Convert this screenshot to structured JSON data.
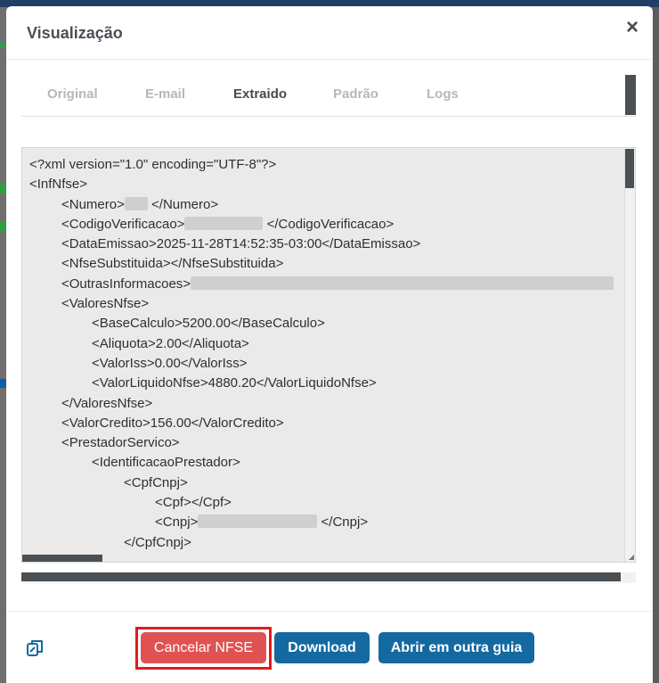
{
  "modal": {
    "title": "Visualização",
    "close_label": "×"
  },
  "tabs": [
    {
      "label": "Original",
      "active": false
    },
    {
      "label": "E-mail",
      "active": false
    },
    {
      "label": "Extraido",
      "active": true
    },
    {
      "label": "Padrão",
      "active": false
    },
    {
      "label": "Logs",
      "active": false
    }
  ],
  "xml": {
    "declaration": "<?xml version=\"1.0\" encoding=\"UTF-8\"?>",
    "inf_open": "<InfNfse>",
    "numero_open": "<Numero>",
    "numero_close": "</Numero>",
    "codver_open": "<CodigoVerificacao>",
    "codver_close": "</CodigoVerificacao>",
    "data_emissao": "<DataEmissao>2025-11-28T14:52:35-03:00</DataEmissao>",
    "nfse_subst": "<NfseSubstituida></NfseSubstituida>",
    "outras_open": "<OutrasInformacoes>",
    "valores_open": "<ValoresNfse>",
    "base_calculo": "<BaseCalculo>5200.00</BaseCalculo>",
    "aliquota": "<Aliquota>2.00</Aliquota>",
    "valor_iss": "<ValorIss>0.00</ValorIss>",
    "valor_liquido": "<ValorLiquidoNfse>4880.20</ValorLiquidoNfse>",
    "valores_close": "</ValoresNfse>",
    "valor_credito": "<ValorCredito>156.00</ValorCredito>",
    "prestador_open": "<PrestadorServico>",
    "ident_open": "<IdentificacaoPrestador>",
    "cpfcnpj_open": "<CpfCnpj>",
    "cpf": "<Cpf></Cpf>",
    "cnpj_open": "<Cnpj>",
    "cnpj_close": "</Cnpj>",
    "cpfcnpj_close": "</CpfCnpj>"
  },
  "footer": {
    "cancel_label": "Cancelar NFSE",
    "download_label": "Download",
    "open_label": "Abrir em outra guia"
  },
  "colors": {
    "primary": "#1469a0",
    "danger": "#e05252",
    "highlight": "#e01b1b"
  }
}
